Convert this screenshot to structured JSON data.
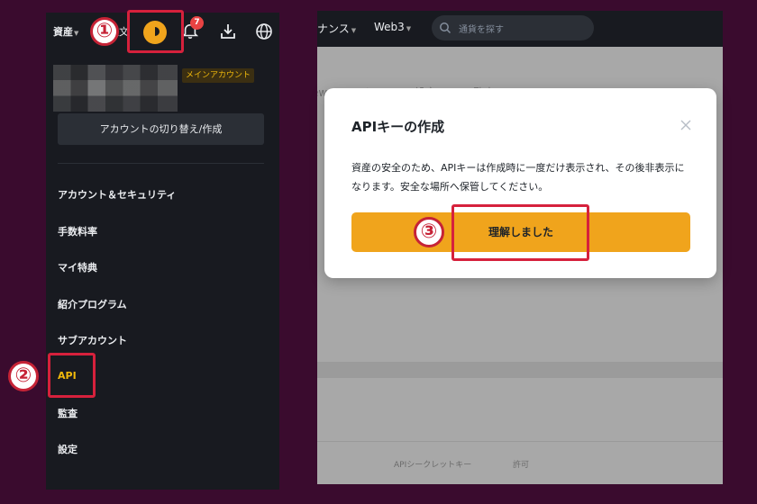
{
  "left": {
    "assets_label": "資産",
    "orders_label": "注文",
    "notification_count": "7",
    "main_account_badge": "メインアカウント",
    "switch_account_button": "アカウントの切り替え/作成",
    "menu": [
      {
        "label": "アカウント＆セキュリティ"
      },
      {
        "label": "手数料率"
      },
      {
        "label": "マイ特典"
      },
      {
        "label": "紹介プログラム"
      },
      {
        "label": "サブアカウント"
      },
      {
        "label": "API"
      },
      {
        "label": "監査"
      },
      {
        "label": "設定"
      }
    ]
  },
  "right": {
    "nav_partial": "ナンス",
    "nav_web3": "Web3",
    "search_placeholder": "通貨を探す",
    "background_tabs": [
      "ew アラート",
      "設定",
      "監査"
    ],
    "footer_left": "APIシークレットキー",
    "footer_right": "許可"
  },
  "modal": {
    "title": "APIキーの作成",
    "body": "資産の安全のため、APIキーは作成時に一度だけ表示され、その後非表示になります。安全な場所へ保管してください。",
    "confirm_button": "理解しました"
  },
  "annotations": {
    "step1": "①",
    "step2": "②",
    "step3": "③"
  },
  "colors": {
    "accent": "#F0A41C",
    "highlight": "#D6213C",
    "active_menu": "#F0B90B",
    "page_background": "#3A0B2E"
  }
}
